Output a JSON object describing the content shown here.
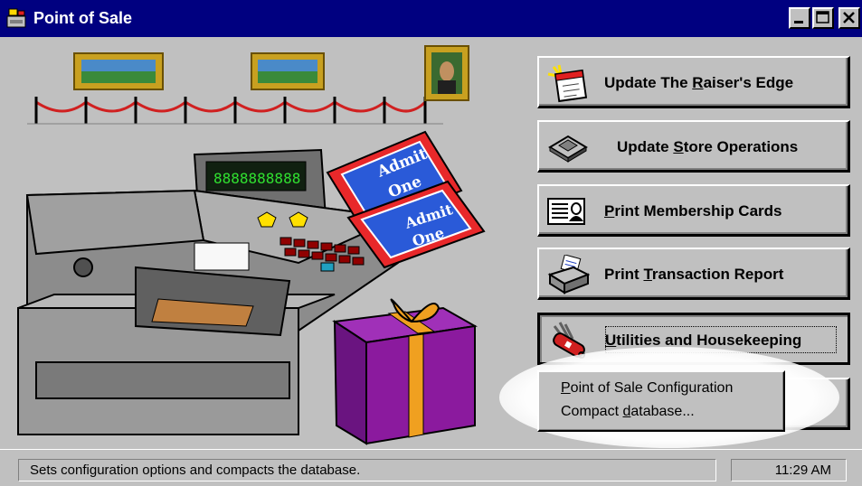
{
  "window": {
    "title": "Point of Sale"
  },
  "art": {
    "register_display": "8888888888",
    "ticket_text_1": "Admit",
    "ticket_text_2": "One"
  },
  "buttons": [
    {
      "label_pre": "Update The ",
      "label_key": "R",
      "label_post": "aiser's Edge",
      "icon": "raisers-edge-notepad-icon"
    },
    {
      "label_pre": "Update ",
      "label_key": "S",
      "label_post": "tore Operations",
      "icon": "floppy-disk-icon"
    },
    {
      "label_pre": "",
      "label_key": "P",
      "label_post": "rint Membership Cards",
      "icon": "membership-card-icon"
    },
    {
      "label_pre": "Print ",
      "label_key": "T",
      "label_post": "ransaction Report",
      "icon": "printer-icon"
    },
    {
      "label_pre": "",
      "label_key": "U",
      "label_post": "tilities and Housekeeping",
      "icon": "swiss-army-knife-icon"
    }
  ],
  "menu": {
    "items": [
      {
        "label_key": "P",
        "label_post": "oint of Sale Configuration"
      },
      {
        "label_pre": "Compact ",
        "label_key": "d",
        "label_post": "atabase..."
      }
    ]
  },
  "status": {
    "text": "Sets configuration options and compacts the database.",
    "time": "11:29 AM"
  },
  "colors": {
    "title_bar": "#000080",
    "face": "#c0c0c0",
    "gift_box": "#8b1a9e",
    "ribbon": "#f0a020",
    "ticket_red": "#e8282a",
    "ticket_blue": "#2a5ad8"
  }
}
